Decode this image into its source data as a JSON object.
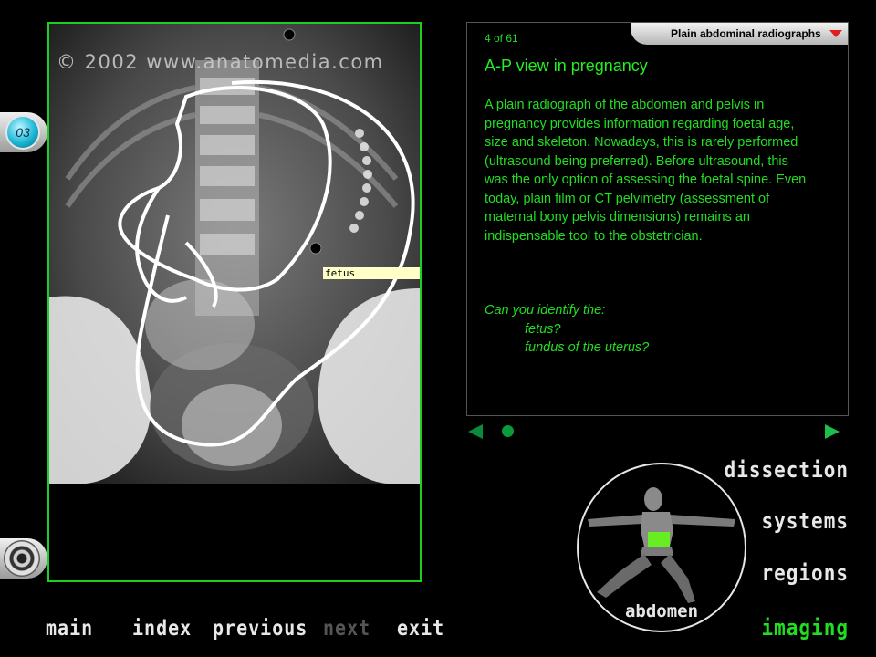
{
  "image": {
    "copyright": "© 2002 www.anatomedia.com",
    "tooltip": "fetus"
  },
  "side": {
    "page_number": "03"
  },
  "text_panel": {
    "section": "Plain abdominal radiographs",
    "counter": "4 of 61",
    "heading": "A-P view in pregnancy",
    "body": "A plain radiograph of the abdomen and pelvis in pregnancy provides information regarding foetal age, size and skeleton. Nowadays, this is rarely performed (ultrasound being preferred). Before ultrasound, this was the only option of assessing the foetal spine. Even today, plain film or CT pelvimetry (assessment of maternal bony pelvis dimensions) remains an indispensable tool to the obstetrician.",
    "question": "Can you identify the:",
    "items": [
      "fetus?",
      "fundus of the uterus?"
    ]
  },
  "right_nav": {
    "dissection": "dissection",
    "systems": "systems",
    "regions": "regions",
    "imaging": "imaging",
    "region_label": "abdomen"
  },
  "bottom_nav": {
    "main": "main",
    "index": "index",
    "previous": "previous",
    "next": "next",
    "exit": "exit"
  },
  "colors": {
    "accent_green": "#22dd22",
    "tooltip_bg": "#ffffc8",
    "tab_arrow": "#e02020"
  }
}
